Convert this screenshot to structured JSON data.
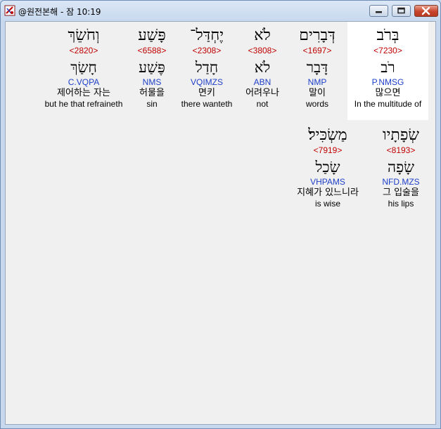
{
  "window": {
    "title": "@원전본해 - 잠 10:19"
  },
  "rows": [
    {
      "words": [
        {
          "hebrew": "בְּרֹב",
          "strong": "<7230>",
          "lemma": "רֹב",
          "morph": "P.NMSG",
          "korean": "많으면",
          "english": "In the multitude of",
          "selected": true
        },
        {
          "hebrew": "דְּבָרִים",
          "strong": "<1697>",
          "lemma": "דָּבָר",
          "morph": "NMP",
          "korean": "말이",
          "english": "words"
        },
        {
          "hebrew": "לֹא",
          "strong": "<3808>",
          "lemma": "לֹא",
          "morph": "ABN",
          "korean": "어려우나",
          "english": "not"
        },
        {
          "hebrew": "יֶחְדַּל־",
          "strong": "<2308>",
          "lemma": "חָדַל",
          "morph": "VQIMZS",
          "korean": "면키",
          "english": "there wanteth"
        },
        {
          "hebrew": "פָּשַׁע",
          "strong": "<6588>",
          "lemma": "פֶּשַׁע",
          "morph": "NMS",
          "korean": "허물을",
          "english": "sin"
        },
        {
          "hebrew": "וְחֹשֵׂךְ",
          "strong": "<2820>",
          "lemma": "חָשַׂךְ",
          "morph": "C.VQPA",
          "korean": "제어하는 자는",
          "english": "but he that refraineth"
        }
      ]
    },
    {
      "words": [
        {
          "hebrew": "שְׂפָתָיו",
          "strong": "<8193>",
          "lemma": "שָׂפָה",
          "morph": "NFD.MZS",
          "korean": "그 입술을",
          "english": "his lips"
        },
        {
          "hebrew": "מַשְׂכִּיל׃",
          "strong": "<7919>",
          "lemma": "שָׂכַל",
          "morph": "VHPAMS",
          "korean": "지혜가 있느니라",
          "english": "is wise"
        }
      ]
    }
  ]
}
